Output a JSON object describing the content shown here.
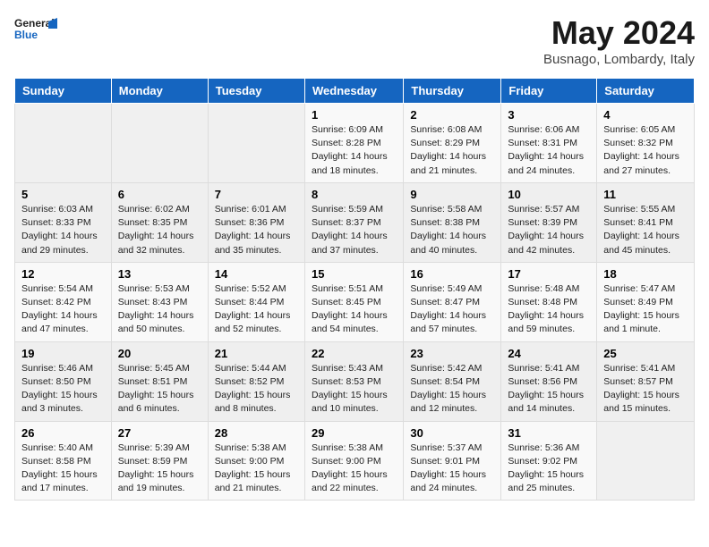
{
  "header": {
    "logo_general": "General",
    "logo_blue": "Blue",
    "month_title": "May 2024",
    "location": "Busnago, Lombardy, Italy"
  },
  "weekdays": [
    "Sunday",
    "Monday",
    "Tuesday",
    "Wednesday",
    "Thursday",
    "Friday",
    "Saturday"
  ],
  "weeks": [
    [
      {
        "day": "",
        "sunrise": "",
        "sunset": "",
        "daylight": ""
      },
      {
        "day": "",
        "sunrise": "",
        "sunset": "",
        "daylight": ""
      },
      {
        "day": "",
        "sunrise": "",
        "sunset": "",
        "daylight": ""
      },
      {
        "day": "1",
        "sunrise": "Sunrise: 6:09 AM",
        "sunset": "Sunset: 8:28 PM",
        "daylight": "Daylight: 14 hours and 18 minutes."
      },
      {
        "day": "2",
        "sunrise": "Sunrise: 6:08 AM",
        "sunset": "Sunset: 8:29 PM",
        "daylight": "Daylight: 14 hours and 21 minutes."
      },
      {
        "day": "3",
        "sunrise": "Sunrise: 6:06 AM",
        "sunset": "Sunset: 8:31 PM",
        "daylight": "Daylight: 14 hours and 24 minutes."
      },
      {
        "day": "4",
        "sunrise": "Sunrise: 6:05 AM",
        "sunset": "Sunset: 8:32 PM",
        "daylight": "Daylight: 14 hours and 27 minutes."
      }
    ],
    [
      {
        "day": "5",
        "sunrise": "Sunrise: 6:03 AM",
        "sunset": "Sunset: 8:33 PM",
        "daylight": "Daylight: 14 hours and 29 minutes."
      },
      {
        "day": "6",
        "sunrise": "Sunrise: 6:02 AM",
        "sunset": "Sunset: 8:35 PM",
        "daylight": "Daylight: 14 hours and 32 minutes."
      },
      {
        "day": "7",
        "sunrise": "Sunrise: 6:01 AM",
        "sunset": "Sunset: 8:36 PM",
        "daylight": "Daylight: 14 hours and 35 minutes."
      },
      {
        "day": "8",
        "sunrise": "Sunrise: 5:59 AM",
        "sunset": "Sunset: 8:37 PM",
        "daylight": "Daylight: 14 hours and 37 minutes."
      },
      {
        "day": "9",
        "sunrise": "Sunrise: 5:58 AM",
        "sunset": "Sunset: 8:38 PM",
        "daylight": "Daylight: 14 hours and 40 minutes."
      },
      {
        "day": "10",
        "sunrise": "Sunrise: 5:57 AM",
        "sunset": "Sunset: 8:39 PM",
        "daylight": "Daylight: 14 hours and 42 minutes."
      },
      {
        "day": "11",
        "sunrise": "Sunrise: 5:55 AM",
        "sunset": "Sunset: 8:41 PM",
        "daylight": "Daylight: 14 hours and 45 minutes."
      }
    ],
    [
      {
        "day": "12",
        "sunrise": "Sunrise: 5:54 AM",
        "sunset": "Sunset: 8:42 PM",
        "daylight": "Daylight: 14 hours and 47 minutes."
      },
      {
        "day": "13",
        "sunrise": "Sunrise: 5:53 AM",
        "sunset": "Sunset: 8:43 PM",
        "daylight": "Daylight: 14 hours and 50 minutes."
      },
      {
        "day": "14",
        "sunrise": "Sunrise: 5:52 AM",
        "sunset": "Sunset: 8:44 PM",
        "daylight": "Daylight: 14 hours and 52 minutes."
      },
      {
        "day": "15",
        "sunrise": "Sunrise: 5:51 AM",
        "sunset": "Sunset: 8:45 PM",
        "daylight": "Daylight: 14 hours and 54 minutes."
      },
      {
        "day": "16",
        "sunrise": "Sunrise: 5:49 AM",
        "sunset": "Sunset: 8:47 PM",
        "daylight": "Daylight: 14 hours and 57 minutes."
      },
      {
        "day": "17",
        "sunrise": "Sunrise: 5:48 AM",
        "sunset": "Sunset: 8:48 PM",
        "daylight": "Daylight: 14 hours and 59 minutes."
      },
      {
        "day": "18",
        "sunrise": "Sunrise: 5:47 AM",
        "sunset": "Sunset: 8:49 PM",
        "daylight": "Daylight: 15 hours and 1 minute."
      }
    ],
    [
      {
        "day": "19",
        "sunrise": "Sunrise: 5:46 AM",
        "sunset": "Sunset: 8:50 PM",
        "daylight": "Daylight: 15 hours and 3 minutes."
      },
      {
        "day": "20",
        "sunrise": "Sunrise: 5:45 AM",
        "sunset": "Sunset: 8:51 PM",
        "daylight": "Daylight: 15 hours and 6 minutes."
      },
      {
        "day": "21",
        "sunrise": "Sunrise: 5:44 AM",
        "sunset": "Sunset: 8:52 PM",
        "daylight": "Daylight: 15 hours and 8 minutes."
      },
      {
        "day": "22",
        "sunrise": "Sunrise: 5:43 AM",
        "sunset": "Sunset: 8:53 PM",
        "daylight": "Daylight: 15 hours and 10 minutes."
      },
      {
        "day": "23",
        "sunrise": "Sunrise: 5:42 AM",
        "sunset": "Sunset: 8:54 PM",
        "daylight": "Daylight: 15 hours and 12 minutes."
      },
      {
        "day": "24",
        "sunrise": "Sunrise: 5:41 AM",
        "sunset": "Sunset: 8:56 PM",
        "daylight": "Daylight: 15 hours and 14 minutes."
      },
      {
        "day": "25",
        "sunrise": "Sunrise: 5:41 AM",
        "sunset": "Sunset: 8:57 PM",
        "daylight": "Daylight: 15 hours and 15 minutes."
      }
    ],
    [
      {
        "day": "26",
        "sunrise": "Sunrise: 5:40 AM",
        "sunset": "Sunset: 8:58 PM",
        "daylight": "Daylight: 15 hours and 17 minutes."
      },
      {
        "day": "27",
        "sunrise": "Sunrise: 5:39 AM",
        "sunset": "Sunset: 8:59 PM",
        "daylight": "Daylight: 15 hours and 19 minutes."
      },
      {
        "day": "28",
        "sunrise": "Sunrise: 5:38 AM",
        "sunset": "Sunset: 9:00 PM",
        "daylight": "Daylight: 15 hours and 21 minutes."
      },
      {
        "day": "29",
        "sunrise": "Sunrise: 5:38 AM",
        "sunset": "Sunset: 9:00 PM",
        "daylight": "Daylight: 15 hours and 22 minutes."
      },
      {
        "day": "30",
        "sunrise": "Sunrise: 5:37 AM",
        "sunset": "Sunset: 9:01 PM",
        "daylight": "Daylight: 15 hours and 24 minutes."
      },
      {
        "day": "31",
        "sunrise": "Sunrise: 5:36 AM",
        "sunset": "Sunset: 9:02 PM",
        "daylight": "Daylight: 15 hours and 25 minutes."
      },
      {
        "day": "",
        "sunrise": "",
        "sunset": "",
        "daylight": ""
      }
    ]
  ]
}
